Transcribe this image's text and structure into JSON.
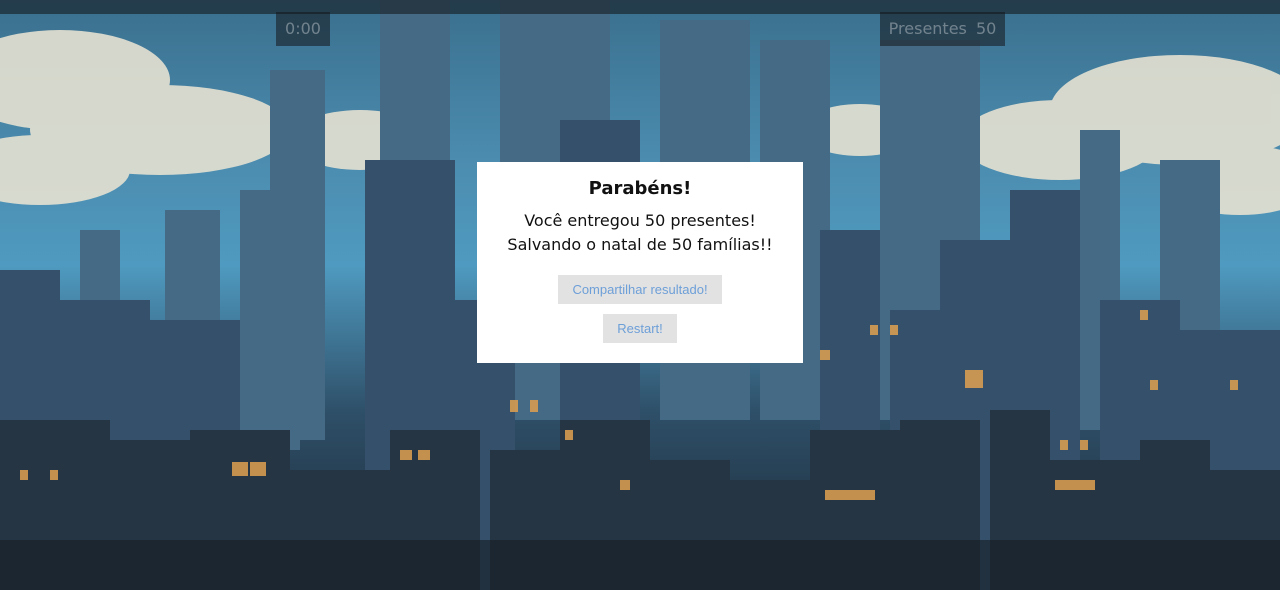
{
  "hud": {
    "timer": "0:00",
    "gifts_label": "Presentes",
    "gifts_count": "50"
  },
  "modal": {
    "title": "Parabéns!",
    "line1": "Você entregou 50 presentes!",
    "line2": "Salvando o natal de 50 famílias!!",
    "share_button": "Compartilhar resultado!",
    "restart_button": "Restart!"
  },
  "scene": {
    "description_colors": {
      "sky_top": "#3a6f8e",
      "sky_mid": "#4f9ac0",
      "cloud": "#e9e6d8",
      "building_dark": "#2a3b4c",
      "building_mid": "#3b5870",
      "window_lit": "#e0a050"
    }
  }
}
